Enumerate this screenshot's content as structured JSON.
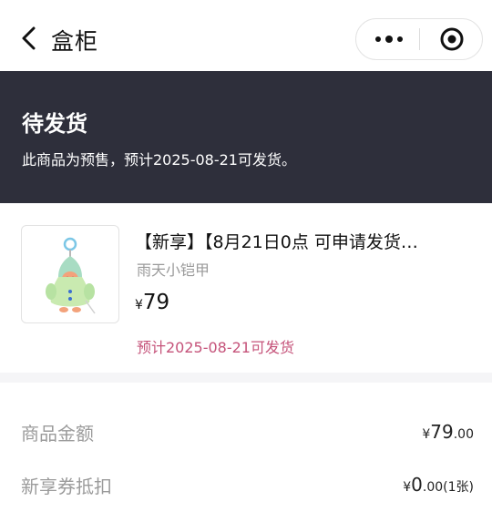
{
  "nav": {
    "title": "盒柜"
  },
  "banner": {
    "status": "待发货",
    "note": "此商品为预售，预计2025-08-21可发货。"
  },
  "product": {
    "name": "【新享】【8月21日0点 可申请发货…",
    "variant": "雨天小铠甲",
    "currency": "¥",
    "price": "79",
    "ship_note": "预计2025-08-21可发货"
  },
  "summary": {
    "goods_amount_label": "商品金额",
    "goods_amount_currency": "¥",
    "goods_amount_int": "79",
    "goods_amount_dec": ".00",
    "coupon_label": "新享券抵扣",
    "coupon_currency": "¥",
    "coupon_int": "0",
    "coupon_dec": ".00",
    "coupon_count": "(1张)"
  },
  "colors": {
    "banner_bg": "#2e2f3b",
    "accent_pink": "#c5537a"
  }
}
